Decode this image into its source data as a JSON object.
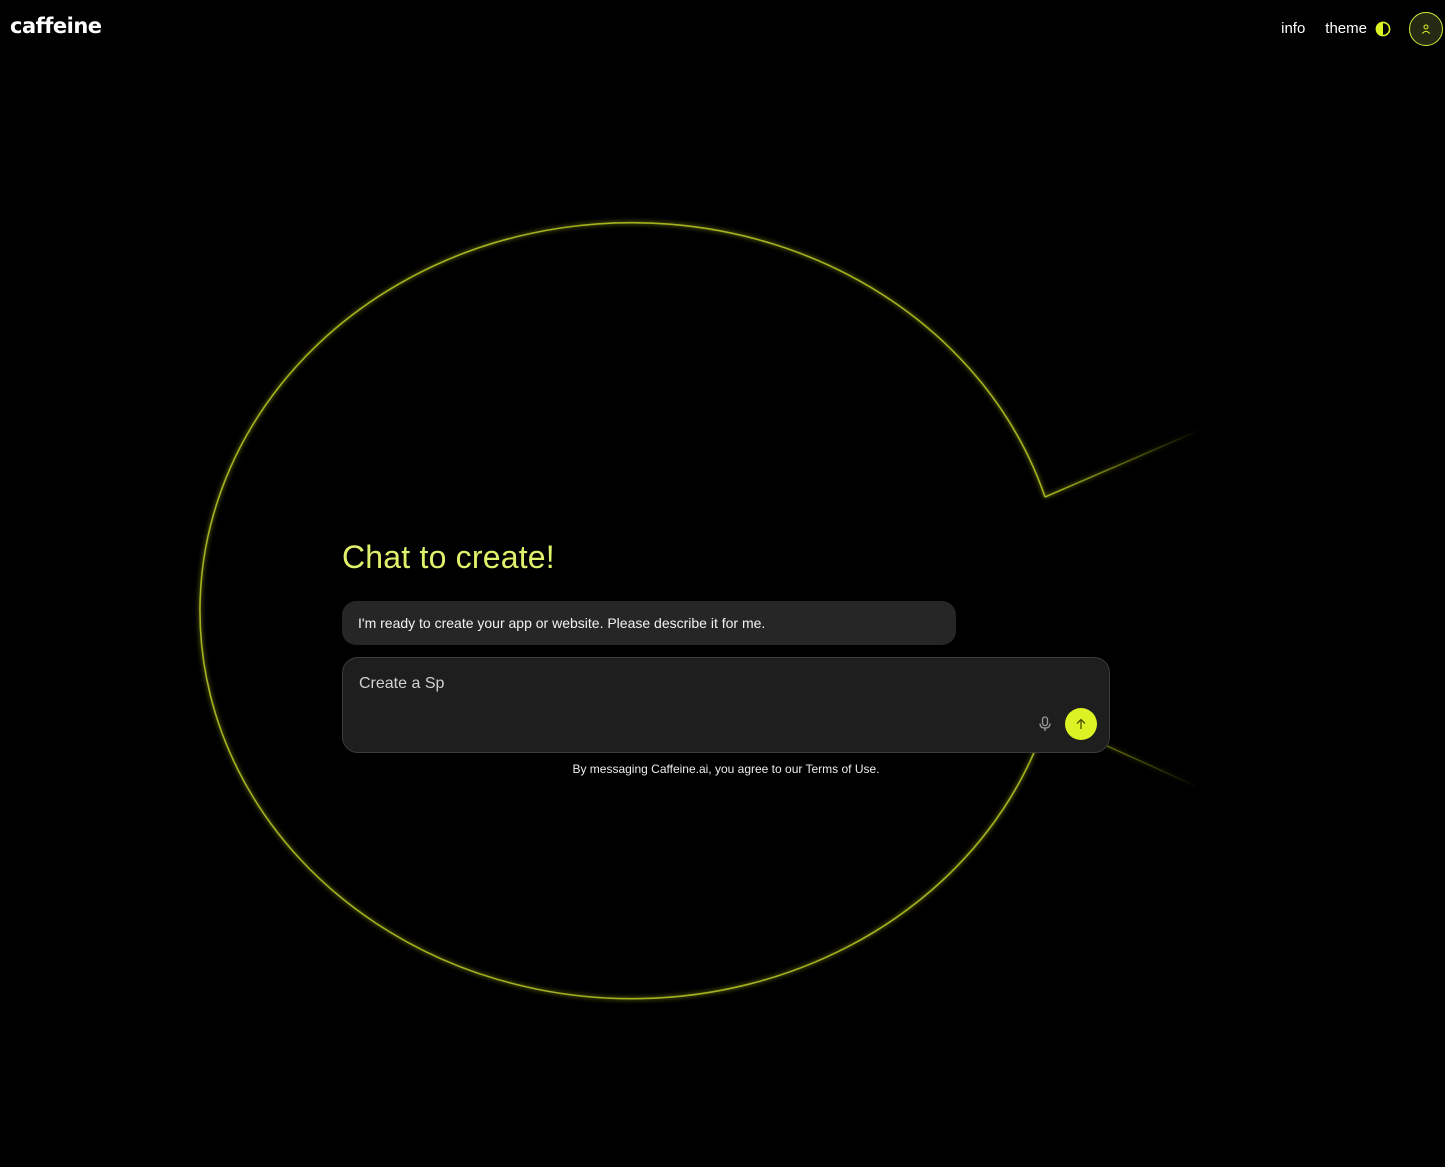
{
  "header": {
    "logo": "caffeine",
    "nav": {
      "info_label": "info",
      "theme_label": "theme"
    }
  },
  "icons": {
    "theme": "half-circle-contrast-icon",
    "avatar": "user-icon",
    "mic": "microphone-icon",
    "send": "arrow-up-icon"
  },
  "colors": {
    "background": "#000000",
    "accent": "#ddf224",
    "title": "#dff06a",
    "outline_glow": "#c8dc22",
    "message_bubble": "#262626",
    "composer_bg": "#1e1e1e"
  },
  "main": {
    "title": "Chat to create!",
    "bot_message": "I'm ready to create your app or website. Please describe it for me.",
    "composer": {
      "value": "Create a Sp",
      "placeholder": ""
    },
    "terms": {
      "prefix": "By messaging Caffeine.ai, you agree to our ",
      "link_label": "Terms of Use",
      "suffix": "."
    }
  }
}
